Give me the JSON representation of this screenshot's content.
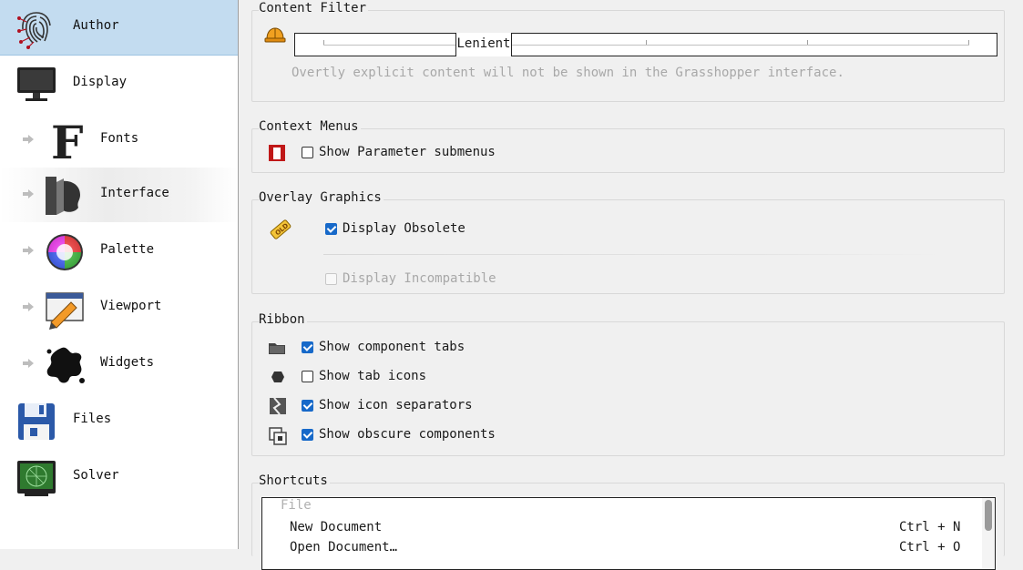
{
  "sidebar": {
    "items": [
      {
        "label": "Author",
        "icon": "fingerprint-icon",
        "level": 0,
        "selected": true
      },
      {
        "label": "Display",
        "icon": "monitor-icon",
        "level": 0
      },
      {
        "label": "Fonts",
        "icon": "font-f-icon",
        "level": 1
      },
      {
        "label": "Interface",
        "icon": "head-profile-icon",
        "level": 1
      },
      {
        "label": "Palette",
        "icon": "color-wheel-icon",
        "level": 1
      },
      {
        "label": "Viewport",
        "icon": "viewport-pencil-icon",
        "level": 1
      },
      {
        "label": "Widgets",
        "icon": "splat-icon",
        "level": 1
      },
      {
        "label": "Files",
        "icon": "floppy-disk-icon",
        "level": 0
      },
      {
        "label": "Solver",
        "icon": "radar-screen-icon",
        "level": 0
      }
    ]
  },
  "content_filter": {
    "title": "Content Filter",
    "slider_value": "Lenient",
    "description": "Overtly explicit content will not be shown in the Grasshopper interface."
  },
  "context_menus": {
    "title": "Context Menus",
    "show_parameter_submenus": {
      "label": "Show Parameter submenus",
      "checked": false
    }
  },
  "overlay_graphics": {
    "title": "Overlay Graphics",
    "display_obsolete": {
      "label": "Display Obsolete",
      "checked": true
    },
    "display_incompatible": {
      "label": "Display Incompatible",
      "checked": false,
      "disabled": true
    }
  },
  "ribbon": {
    "title": "Ribbon",
    "options": [
      {
        "label": "Show component tabs",
        "checked": true,
        "icon": "folder-tab-icon"
      },
      {
        "label": "Show tab icons",
        "checked": false,
        "icon": "hexagon-icon"
      },
      {
        "label": "Show icon separators",
        "checked": true,
        "icon": "separator-icon"
      },
      {
        "label": "Show obscure components",
        "checked": true,
        "icon": "obscure-components-icon"
      }
    ]
  },
  "shortcuts": {
    "title": "Shortcuts",
    "category": "File",
    "rows": [
      {
        "name": "New Document",
        "key": "Ctrl + N"
      },
      {
        "name": "Open Document…",
        "key": "Ctrl + O"
      }
    ]
  },
  "colors": {
    "selected_bg": "#c3dcf0",
    "checkbox_on": "#1769c9",
    "background": "#f0f0f0"
  }
}
